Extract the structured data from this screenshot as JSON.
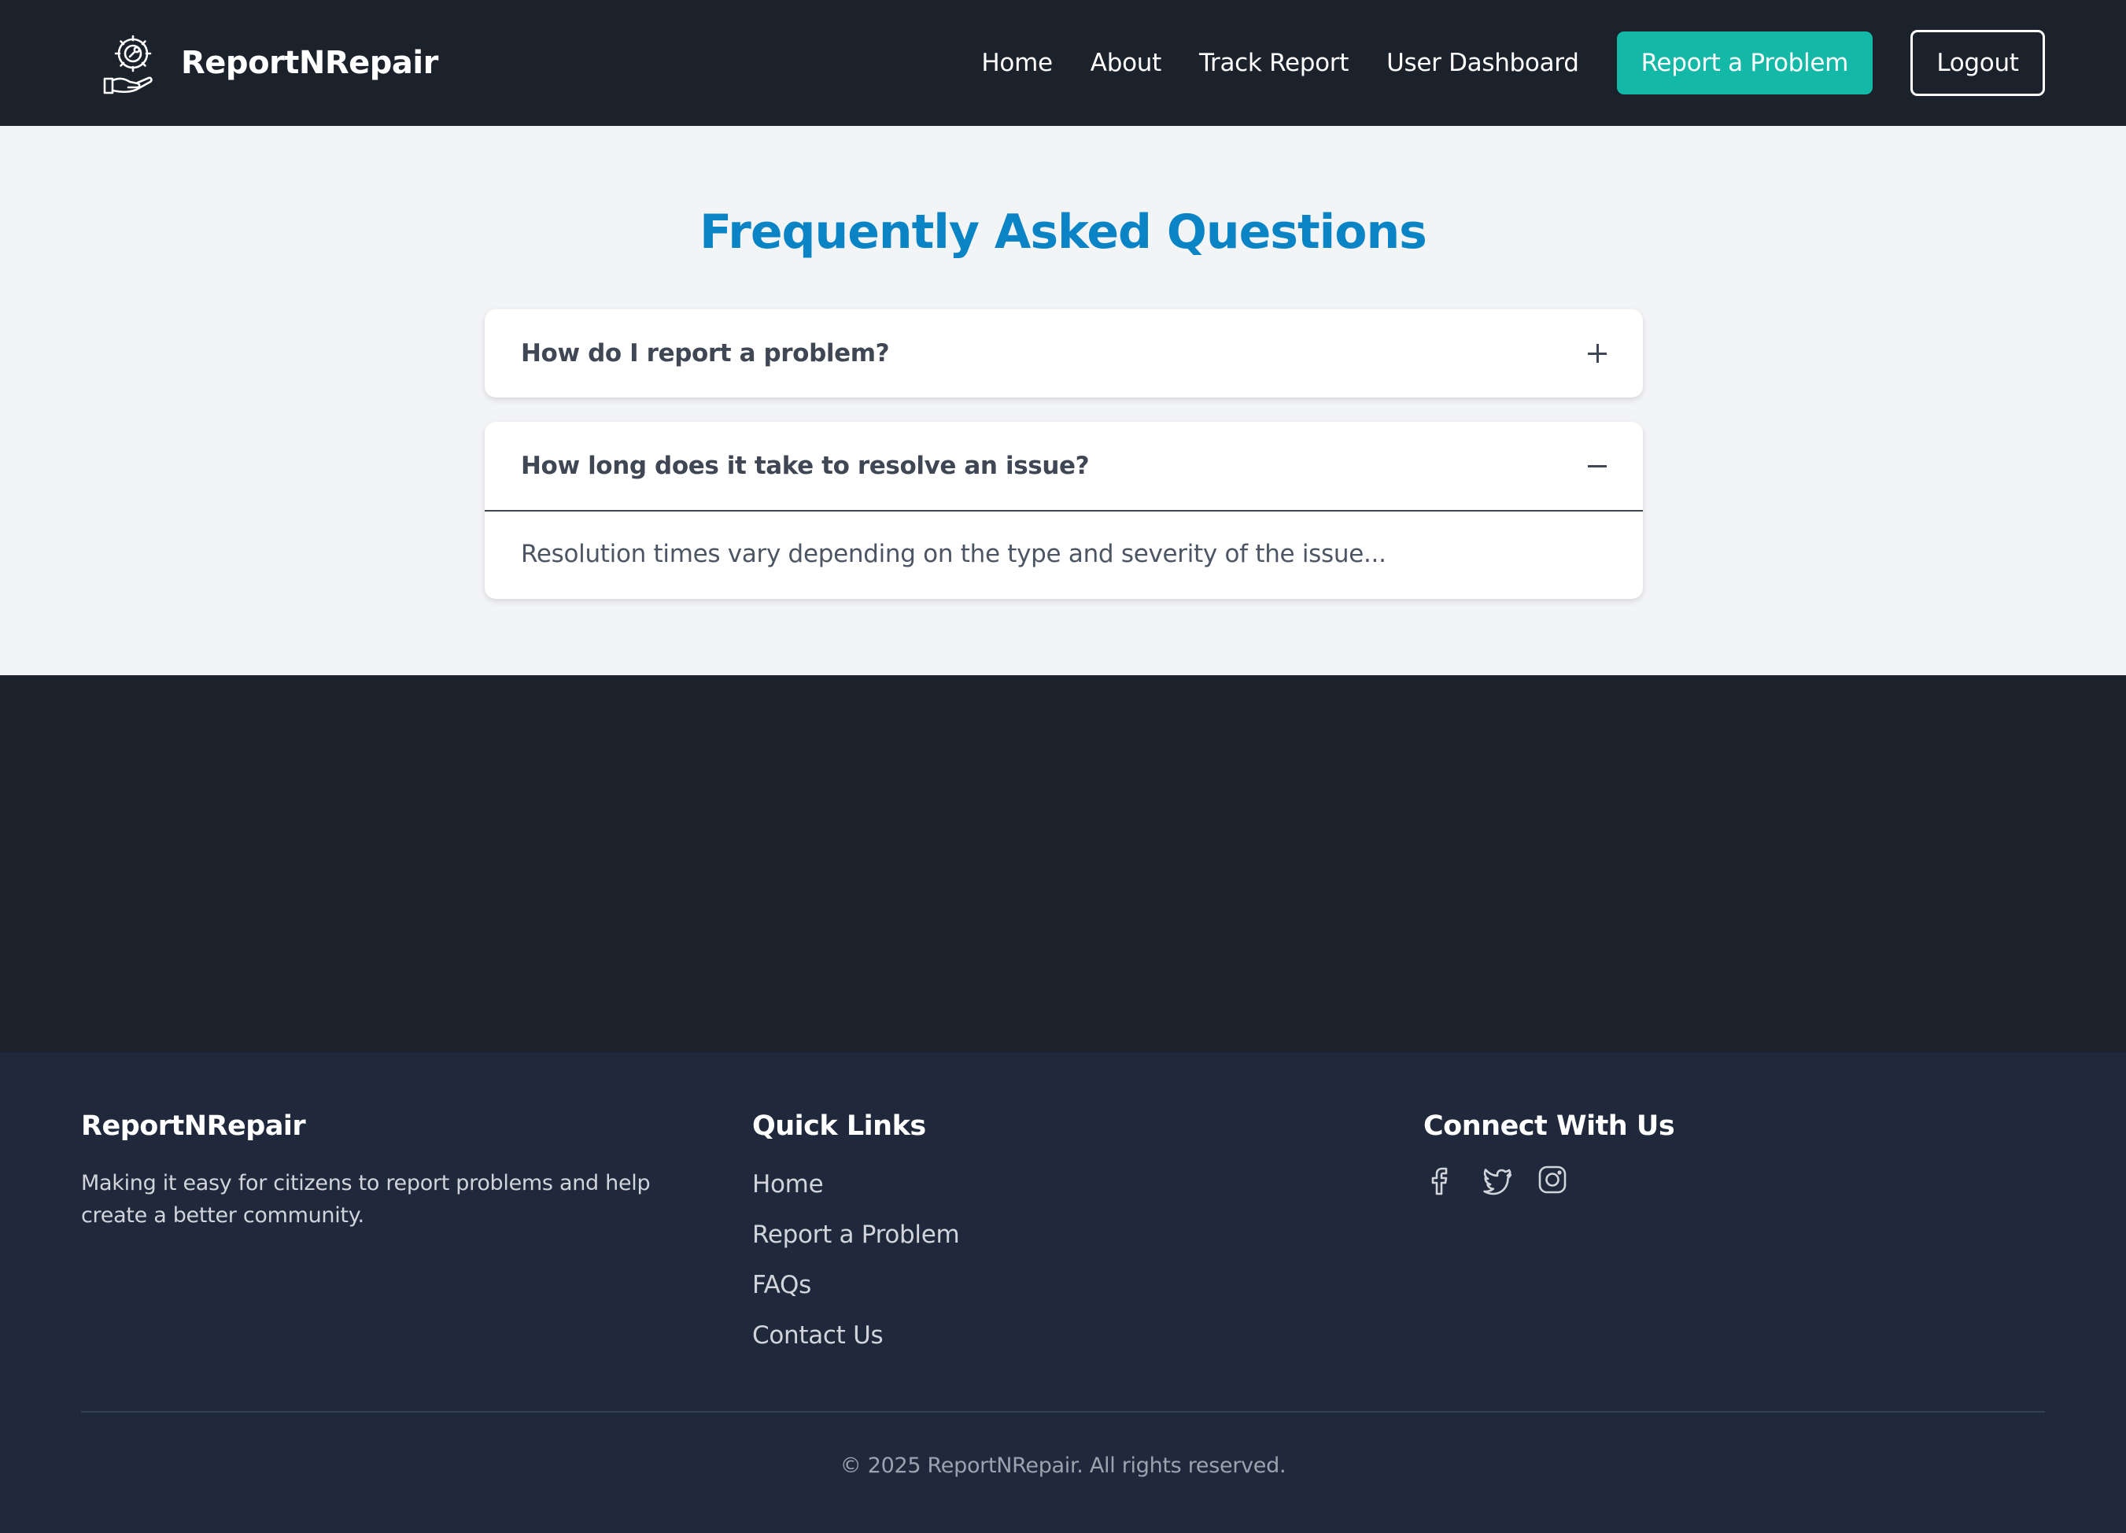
{
  "brand": {
    "name": "ReportNRepair",
    "logo_icon": "gear-hand-icon"
  },
  "nav": {
    "links": [
      "Home",
      "About",
      "Track Report",
      "User Dashboard"
    ],
    "report_button": "Report a Problem",
    "logout_button": "Logout"
  },
  "faq": {
    "title": "Frequently Asked Questions",
    "items": [
      {
        "question": "How do I report a problem?",
        "expanded": false,
        "icon": "plus-icon"
      },
      {
        "question": "How long does it take to resolve an issue?",
        "expanded": true,
        "icon": "minus-icon",
        "answer": "Resolution times vary depending on the type and severity of the issue..."
      }
    ]
  },
  "footer": {
    "about": {
      "heading": "ReportNRepair",
      "description": "Making it easy for citizens to report problems and help create a better community."
    },
    "quick_links": {
      "heading": "Quick Links",
      "links": [
        "Home",
        "Report a Problem",
        "FAQs",
        "Contact Us"
      ]
    },
    "connect": {
      "heading": "Connect With Us",
      "icons": [
        "facebook-icon",
        "twitter-icon",
        "instagram-icon"
      ]
    },
    "copyright": "© 2025 ReportNRepair. All rights reserved."
  },
  "colors": {
    "nav_bg": "#1c222c",
    "accent_teal": "#14b8a6",
    "faq_title_blue": "#0b84c6",
    "footer_bg": "#1f293b",
    "section_bg": "#f3f4f6"
  }
}
